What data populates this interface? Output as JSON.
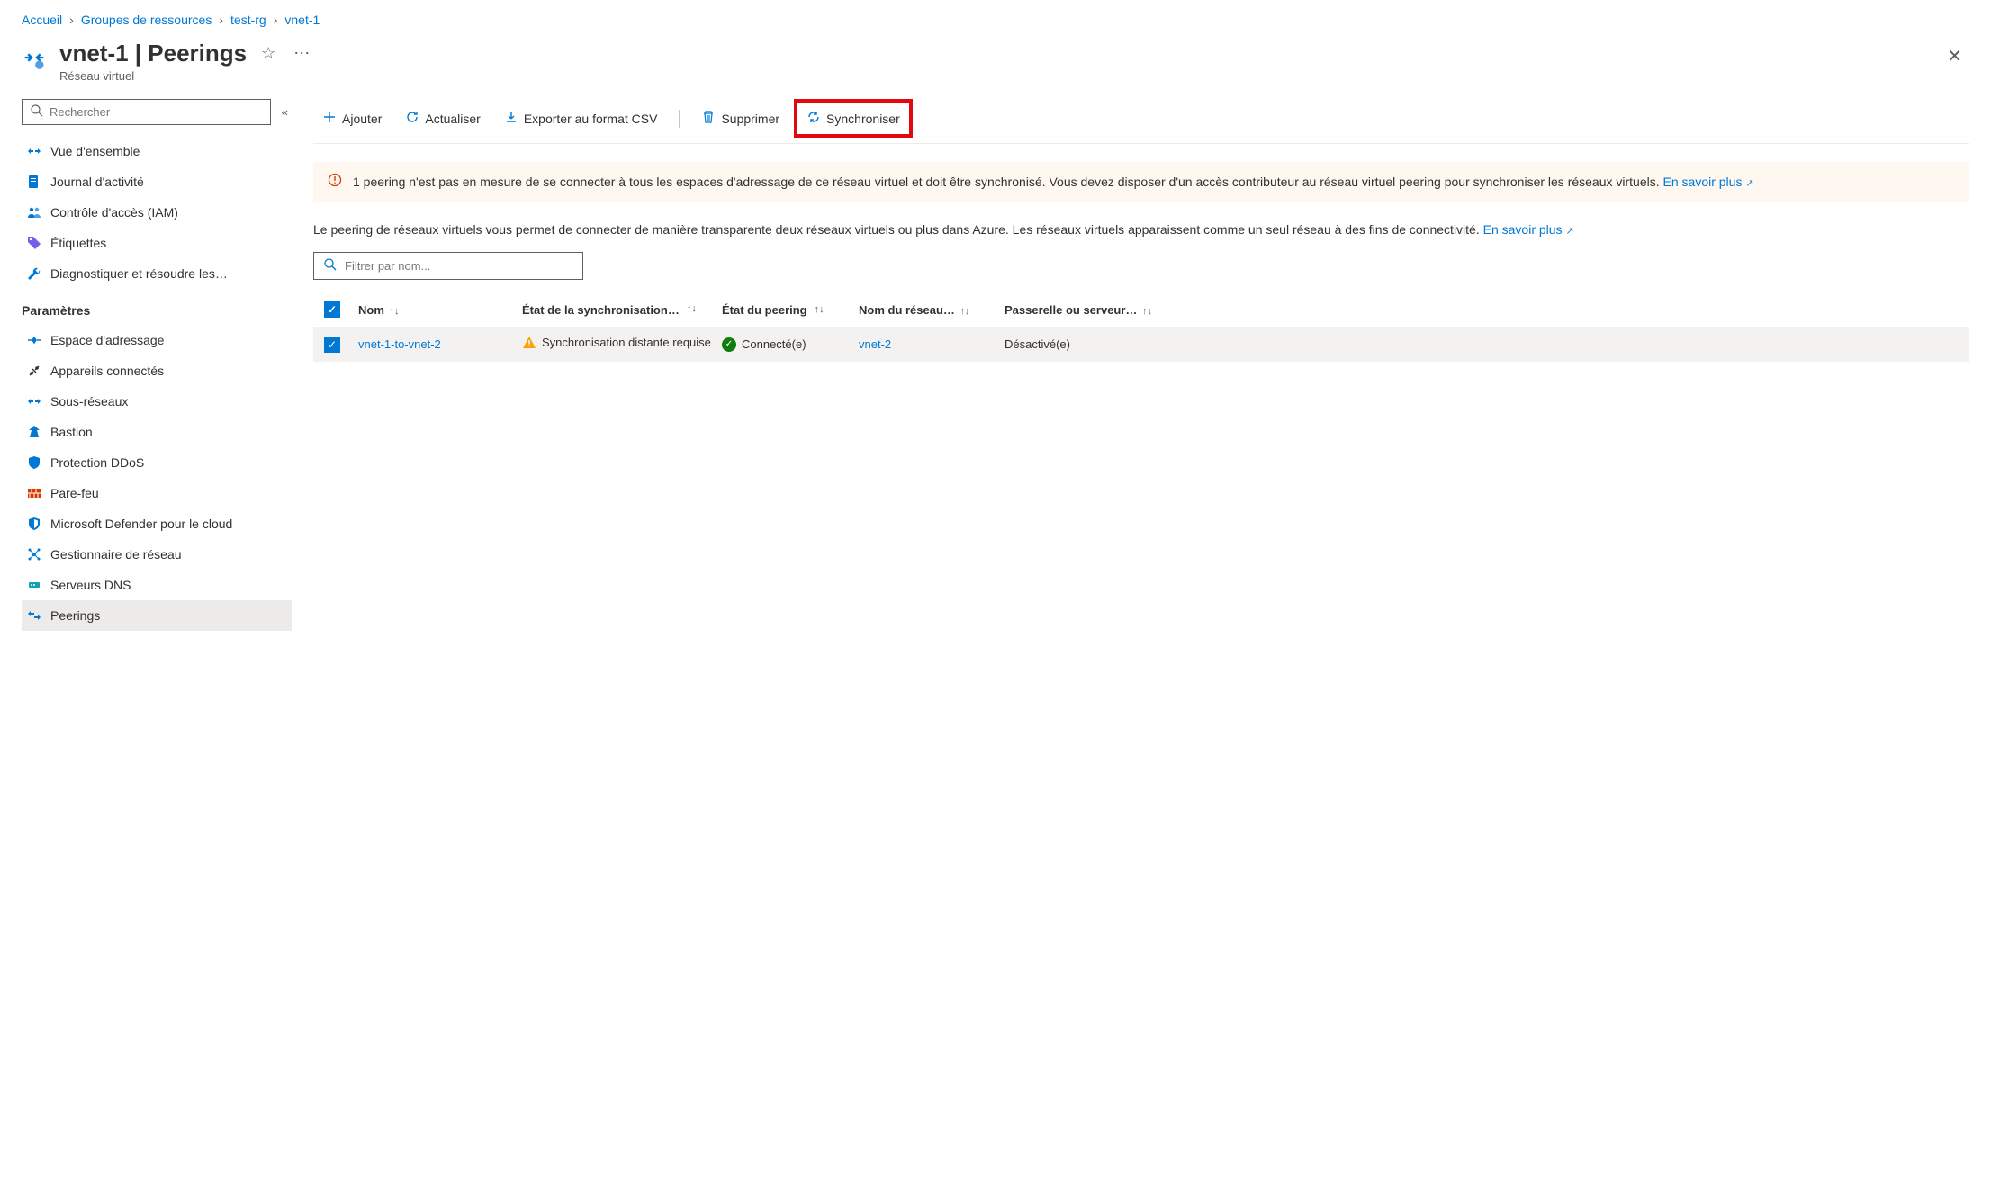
{
  "breadcrumbs": [
    "Accueil",
    "Groupes de ressources",
    "test-rg",
    "vnet-1"
  ],
  "header": {
    "title": "vnet-1 | Peerings",
    "subtitle": "Réseau virtuel"
  },
  "sidebar": {
    "search_placeholder": "Rechercher",
    "items_top": [
      {
        "label": "Vue d'ensemble"
      },
      {
        "label": "Journal d'activité"
      },
      {
        "label": "Contrôle d'accès (IAM)"
      },
      {
        "label": "Étiquettes"
      },
      {
        "label": "Diagnostiquer et résoudre les…"
      }
    ],
    "section1": "Paramètres",
    "items_settings": [
      {
        "label": "Espace d'adressage"
      },
      {
        "label": "Appareils connectés"
      },
      {
        "label": "Sous-réseaux"
      },
      {
        "label": "Bastion"
      },
      {
        "label": "Protection DDoS"
      },
      {
        "label": "Pare-feu"
      },
      {
        "label": "Microsoft Defender pour le cloud"
      },
      {
        "label": "Gestionnaire de réseau"
      },
      {
        "label": "Serveurs DNS"
      },
      {
        "label": "Peerings"
      }
    ]
  },
  "toolbar": {
    "add": "Ajouter",
    "refresh": "Actualiser",
    "export": "Exporter au format CSV",
    "delete": "Supprimer",
    "sync": "Synchroniser"
  },
  "banner": {
    "text": "1 peering n'est pas en mesure de se connecter à tous les espaces d'adressage de ce réseau virtuel et doit être synchronisé. Vous devez disposer d'un accès contributeur au réseau virtuel peering pour synchroniser les réseaux virtuels.",
    "link": "En savoir plus"
  },
  "description": {
    "text": "Le peering de réseaux virtuels vous permet de connecter de manière transparente deux réseaux virtuels ou plus dans Azure. Les réseaux virtuels apparaissent comme un seul réseau à des fins de connectivité.",
    "link": "En savoir plus"
  },
  "filter_placeholder": "Filtrer par nom...",
  "table": {
    "columns": {
      "name": "Nom",
      "sync": "État de la synchronisation…",
      "peer": "État du peering",
      "net": "Nom du réseau…",
      "gateway": "Passerelle ou serveur…"
    },
    "rows": [
      {
        "name": "vnet-1-to-vnet-2",
        "sync": "Synchronisation distante requise",
        "peer": "Connecté(e)",
        "net": "vnet-2",
        "gateway": "Désactivé(e)"
      }
    ]
  }
}
